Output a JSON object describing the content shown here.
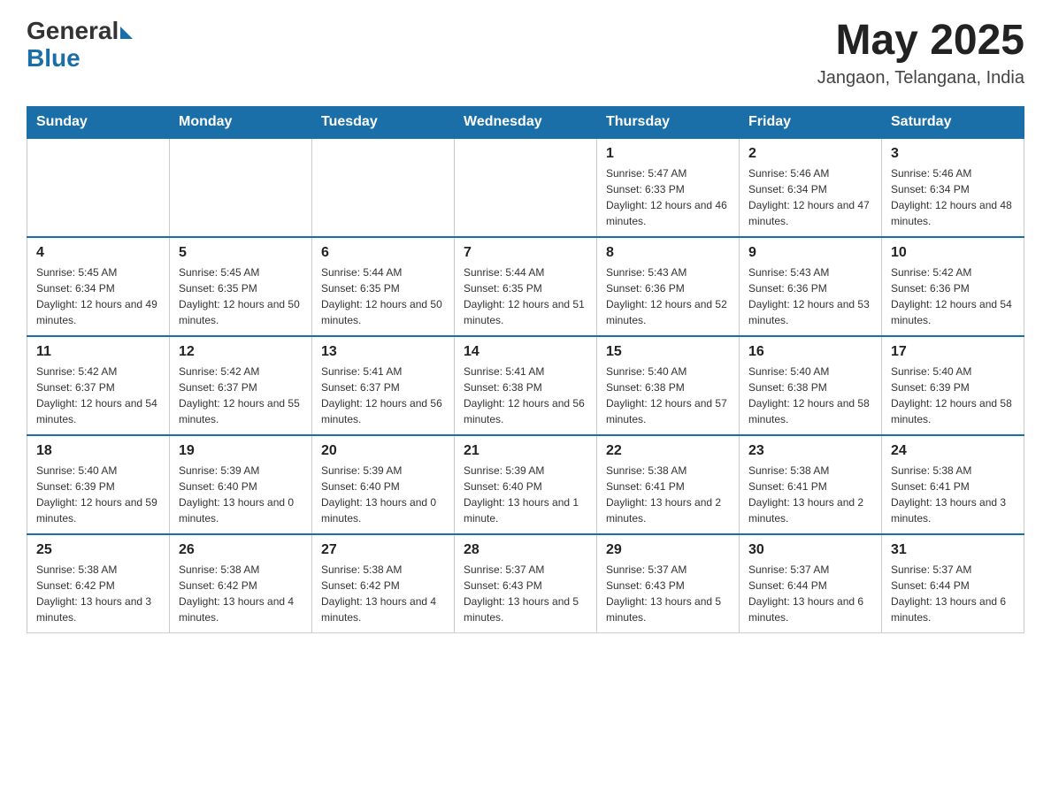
{
  "header": {
    "logo_general": "General",
    "logo_blue": "Blue",
    "month_year": "May 2025",
    "location": "Jangaon, Telangana, India"
  },
  "weekdays": [
    "Sunday",
    "Monday",
    "Tuesday",
    "Wednesday",
    "Thursday",
    "Friday",
    "Saturday"
  ],
  "weeks": [
    [
      {
        "day": "",
        "info": ""
      },
      {
        "day": "",
        "info": ""
      },
      {
        "day": "",
        "info": ""
      },
      {
        "day": "",
        "info": ""
      },
      {
        "day": "1",
        "info": "Sunrise: 5:47 AM\nSunset: 6:33 PM\nDaylight: 12 hours and 46 minutes."
      },
      {
        "day": "2",
        "info": "Sunrise: 5:46 AM\nSunset: 6:34 PM\nDaylight: 12 hours and 47 minutes."
      },
      {
        "day": "3",
        "info": "Sunrise: 5:46 AM\nSunset: 6:34 PM\nDaylight: 12 hours and 48 minutes."
      }
    ],
    [
      {
        "day": "4",
        "info": "Sunrise: 5:45 AM\nSunset: 6:34 PM\nDaylight: 12 hours and 49 minutes."
      },
      {
        "day": "5",
        "info": "Sunrise: 5:45 AM\nSunset: 6:35 PM\nDaylight: 12 hours and 50 minutes."
      },
      {
        "day": "6",
        "info": "Sunrise: 5:44 AM\nSunset: 6:35 PM\nDaylight: 12 hours and 50 minutes."
      },
      {
        "day": "7",
        "info": "Sunrise: 5:44 AM\nSunset: 6:35 PM\nDaylight: 12 hours and 51 minutes."
      },
      {
        "day": "8",
        "info": "Sunrise: 5:43 AM\nSunset: 6:36 PM\nDaylight: 12 hours and 52 minutes."
      },
      {
        "day": "9",
        "info": "Sunrise: 5:43 AM\nSunset: 6:36 PM\nDaylight: 12 hours and 53 minutes."
      },
      {
        "day": "10",
        "info": "Sunrise: 5:42 AM\nSunset: 6:36 PM\nDaylight: 12 hours and 54 minutes."
      }
    ],
    [
      {
        "day": "11",
        "info": "Sunrise: 5:42 AM\nSunset: 6:37 PM\nDaylight: 12 hours and 54 minutes."
      },
      {
        "day": "12",
        "info": "Sunrise: 5:42 AM\nSunset: 6:37 PM\nDaylight: 12 hours and 55 minutes."
      },
      {
        "day": "13",
        "info": "Sunrise: 5:41 AM\nSunset: 6:37 PM\nDaylight: 12 hours and 56 minutes."
      },
      {
        "day": "14",
        "info": "Sunrise: 5:41 AM\nSunset: 6:38 PM\nDaylight: 12 hours and 56 minutes."
      },
      {
        "day": "15",
        "info": "Sunrise: 5:40 AM\nSunset: 6:38 PM\nDaylight: 12 hours and 57 minutes."
      },
      {
        "day": "16",
        "info": "Sunrise: 5:40 AM\nSunset: 6:38 PM\nDaylight: 12 hours and 58 minutes."
      },
      {
        "day": "17",
        "info": "Sunrise: 5:40 AM\nSunset: 6:39 PM\nDaylight: 12 hours and 58 minutes."
      }
    ],
    [
      {
        "day": "18",
        "info": "Sunrise: 5:40 AM\nSunset: 6:39 PM\nDaylight: 12 hours and 59 minutes."
      },
      {
        "day": "19",
        "info": "Sunrise: 5:39 AM\nSunset: 6:40 PM\nDaylight: 13 hours and 0 minutes."
      },
      {
        "day": "20",
        "info": "Sunrise: 5:39 AM\nSunset: 6:40 PM\nDaylight: 13 hours and 0 minutes."
      },
      {
        "day": "21",
        "info": "Sunrise: 5:39 AM\nSunset: 6:40 PM\nDaylight: 13 hours and 1 minute."
      },
      {
        "day": "22",
        "info": "Sunrise: 5:38 AM\nSunset: 6:41 PM\nDaylight: 13 hours and 2 minutes."
      },
      {
        "day": "23",
        "info": "Sunrise: 5:38 AM\nSunset: 6:41 PM\nDaylight: 13 hours and 2 minutes."
      },
      {
        "day": "24",
        "info": "Sunrise: 5:38 AM\nSunset: 6:41 PM\nDaylight: 13 hours and 3 minutes."
      }
    ],
    [
      {
        "day": "25",
        "info": "Sunrise: 5:38 AM\nSunset: 6:42 PM\nDaylight: 13 hours and 3 minutes."
      },
      {
        "day": "26",
        "info": "Sunrise: 5:38 AM\nSunset: 6:42 PM\nDaylight: 13 hours and 4 minutes."
      },
      {
        "day": "27",
        "info": "Sunrise: 5:38 AM\nSunset: 6:42 PM\nDaylight: 13 hours and 4 minutes."
      },
      {
        "day": "28",
        "info": "Sunrise: 5:37 AM\nSunset: 6:43 PM\nDaylight: 13 hours and 5 minutes."
      },
      {
        "day": "29",
        "info": "Sunrise: 5:37 AM\nSunset: 6:43 PM\nDaylight: 13 hours and 5 minutes."
      },
      {
        "day": "30",
        "info": "Sunrise: 5:37 AM\nSunset: 6:44 PM\nDaylight: 13 hours and 6 minutes."
      },
      {
        "day": "31",
        "info": "Sunrise: 5:37 AM\nSunset: 6:44 PM\nDaylight: 13 hours and 6 minutes."
      }
    ]
  ]
}
